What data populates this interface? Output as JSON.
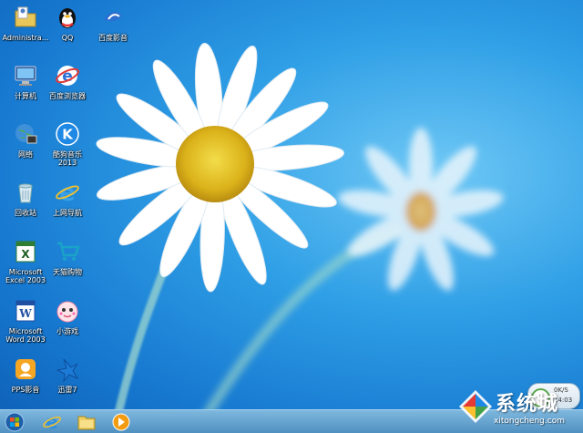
{
  "desktop_icons": [
    {
      "label": "Administra...",
      "icon": "user-folder-icon"
    },
    {
      "label": "QQ",
      "icon": "qq-penguin-icon"
    },
    {
      "label": "百度影音",
      "icon": "baidu-video-icon"
    },
    {
      "label": "计算机",
      "icon": "computer-icon"
    },
    {
      "label": "百度浏览器",
      "icon": "baidu-browser-icon"
    },
    {
      "label": "网络",
      "icon": "network-icon"
    },
    {
      "label": "酷狗音乐\n2013",
      "icon": "kugou-music-icon"
    },
    {
      "label": "回收站",
      "icon": "recycle-bin-icon"
    },
    {
      "label": "上网导航",
      "icon": "ie-navigation-icon"
    },
    {
      "label": "Microsoft\nExcel 2003",
      "icon": "excel-icon"
    },
    {
      "label": "天猫购物",
      "icon": "shopping-cart-icon"
    },
    {
      "label": "Microsoft\nWord 2003",
      "icon": "word-icon"
    },
    {
      "label": "小游戏",
      "icon": "mini-game-icon"
    },
    {
      "label": "PPS影音",
      "icon": "pps-player-icon"
    },
    {
      "label": "迅雷7",
      "icon": "thunder-icon"
    }
  ],
  "taskbar": {
    "items": [
      {
        "icon": "start-orb-icon"
      },
      {
        "icon": "internet-explorer-icon"
      },
      {
        "icon": "file-explorer-icon"
      },
      {
        "icon": "media-player-icon"
      }
    ]
  },
  "speed_widget": {
    "percent": "3",
    "rate": "0K/S",
    "time": "14:03"
  },
  "watermark": {
    "brand": "系统城",
    "url": "xitongcheng.com"
  },
  "colors": {
    "sky": "#2f9fe6",
    "taskbar": "#6aa7d4",
    "daisy_center": "#e9c21f",
    "petal": "#ffffff"
  }
}
